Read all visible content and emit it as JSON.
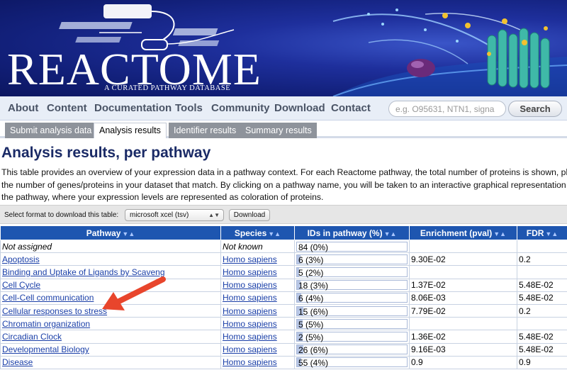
{
  "banner": {
    "logo": "REACTOME",
    "tagline": "A CURATED PATHWAY DATABASE"
  },
  "nav": {
    "items": [
      "About",
      "Content",
      "Documentation",
      "Tools",
      "Community",
      "Download",
      "Contact"
    ],
    "search_placeholder": "e.g. O95631, NTN1, signa",
    "search_button": "Search"
  },
  "subtabs": [
    {
      "label": "Submit analysis data",
      "active": false
    },
    {
      "label": "Analysis results",
      "active": true
    },
    {
      "label": "Identifier results",
      "active": false
    },
    {
      "label": "Summary results",
      "active": false
    }
  ],
  "page": {
    "title": "Analysis results, per pathway",
    "intro": "This table provides an overview of your expression data in a pathway context. For each Reactome pathway, the total number of proteins is shown, plus the number of genes/proteins in your dataset that match. By clicking on a pathway name, you will be taken to an interactive graphical representation of the pathway, where your expression levels are represented as coloration of proteins."
  },
  "download": {
    "label": "Select format to download this table:",
    "selected": "microsoft xcel (tsv)",
    "button": "Download"
  },
  "table": {
    "columns": [
      "Pathway",
      "Species",
      "IDs in pathway (%)",
      "Enrichment (pval)",
      "FDR"
    ],
    "rows": [
      {
        "pathway": "Not assigned",
        "species": "Not known",
        "ids": "84 (0%)",
        "pct": 0,
        "enrichment": "",
        "fdr": "",
        "link": false
      },
      {
        "pathway": "Apoptosis",
        "species": "Homo sapiens",
        "ids": "6 (3%)",
        "pct": 3,
        "enrichment": "9.30E-02",
        "fdr": "0.2",
        "link": true
      },
      {
        "pathway": "Binding and Uptake of Ligands by Scaveng",
        "species": "Homo sapiens",
        "ids": "5 (2%)",
        "pct": 2,
        "enrichment": "",
        "fdr": "",
        "link": true
      },
      {
        "pathway": "Cell Cycle",
        "species": "Homo sapiens",
        "ids": "18 (3%)",
        "pct": 3,
        "enrichment": "1.37E-02",
        "fdr": "5.48E-02",
        "link": true
      },
      {
        "pathway": "Cell-Cell communication",
        "species": "Homo sapiens",
        "ids": "6 (4%)",
        "pct": 4,
        "enrichment": "8.06E-03",
        "fdr": "5.48E-02",
        "link": true
      },
      {
        "pathway": "Cellular responses to stress",
        "species": "Homo sapiens",
        "ids": "15 (6%)",
        "pct": 6,
        "enrichment": "7.79E-02",
        "fdr": "0.2",
        "link": true
      },
      {
        "pathway": "Chromatin organization",
        "species": "Homo sapiens",
        "ids": "5 (5%)",
        "pct": 5,
        "enrichment": "",
        "fdr": "",
        "link": true
      },
      {
        "pathway": "Circadian Clock",
        "species": "Homo sapiens",
        "ids": "2 (5%)",
        "pct": 5,
        "enrichment": "1.36E-02",
        "fdr": "5.48E-02",
        "link": true
      },
      {
        "pathway": "Developmental Biology",
        "species": "Homo sapiens",
        "ids": "26 (6%)",
        "pct": 6,
        "enrichment": "9.16E-03",
        "fdr": "5.48E-02",
        "link": true
      },
      {
        "pathway": "Disease",
        "species": "Homo sapiens",
        "ids": "55 (4%)",
        "pct": 4,
        "enrichment": "0.9",
        "fdr": "0.9",
        "link": true
      }
    ]
  },
  "colors": {
    "header_bg": "#1e56b0",
    "link": "#1a3fa8",
    "arrow": "#e8452c"
  }
}
